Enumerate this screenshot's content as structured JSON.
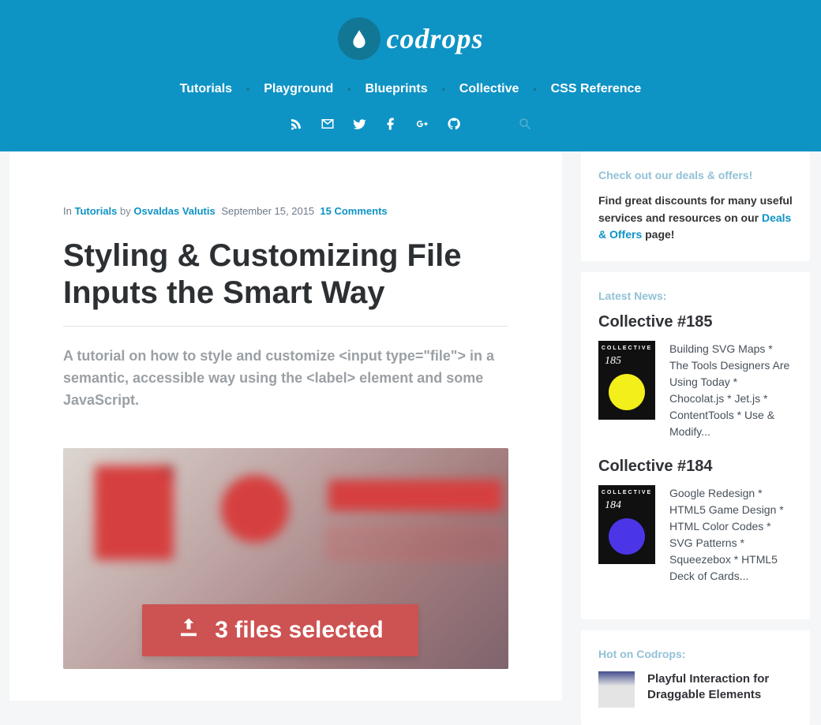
{
  "site": {
    "name": "codrops"
  },
  "nav": {
    "items": [
      "Tutorials",
      "Playground",
      "Blueprints",
      "Collective",
      "CSS Reference"
    ]
  },
  "social": {
    "icons": [
      "rss",
      "email",
      "twitter",
      "facebook",
      "gplus",
      "github"
    ]
  },
  "article": {
    "meta": {
      "in_label": "In",
      "category": "Tutorials",
      "by_label": "by",
      "author": "Osvaldas Valutis",
      "date": "September 15, 2015",
      "comments": "15 Comments"
    },
    "title": "Styling & Customizing File Inputs the Smart Way",
    "subtitle": "A tutorial on how to style and customize <input type=\"file\"> in a semantic, accessible way using the <label> element and some JavaScript.",
    "hero_button": "3 files selected"
  },
  "sidebar": {
    "deals": {
      "heading": "Check out our deals & offers!",
      "line1": "Find great discounts for many useful services and resources on our ",
      "link": "Deals & Offers",
      "line2": " page!"
    },
    "news": {
      "heading": "Latest News:",
      "items": [
        {
          "title": "Collective #185",
          "thumb_badge": "COLLECTIVE",
          "thumb_num": "185",
          "color": "#f2ef1b",
          "desc": "Building SVG Maps * The Tools Designers Are Using Today * Chocolat.js * Jet.js * ContentTools * Use & Modify..."
        },
        {
          "title": "Collective #184",
          "thumb_badge": "COLLECTIVE",
          "thumb_num": "184",
          "color": "#4a36e6",
          "desc": "Google Redesign * HTML5 Game Design * HTML Color Codes * SVG Patterns * Squeezebox * HTML5 Deck of Cards..."
        }
      ]
    },
    "hot": {
      "heading": "Hot on Codrops:",
      "items": [
        {
          "title": "Playful Interaction for Draggable Elements"
        }
      ]
    }
  }
}
